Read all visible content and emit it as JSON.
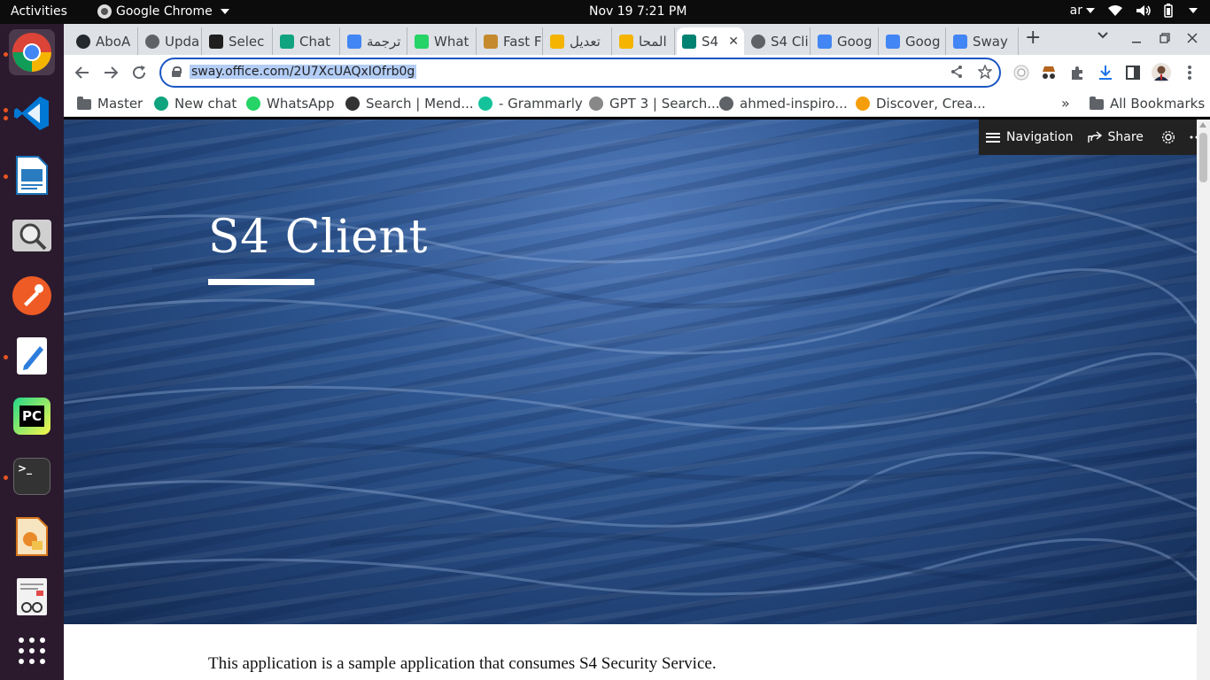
{
  "system": {
    "activities": "Activities",
    "app_name": "Google Chrome",
    "clock": "Nov 19  7:21 PM",
    "keyboard_layout": "ar"
  },
  "tabs": [
    {
      "label": "AboA",
      "icon": "github-icon",
      "color": "#24292e"
    },
    {
      "label": "Upda",
      "icon": "globe-icon",
      "color": "#5f6368"
    },
    {
      "label": "Selec",
      "icon": "a-logo-icon",
      "color": "#1f1f1f"
    },
    {
      "label": "Chat",
      "icon": "openai-icon",
      "color": "#10a37f"
    },
    {
      "label": "ترجمة",
      "icon": "google-translate-icon",
      "color": "#4285f4"
    },
    {
      "label": "What",
      "icon": "whatsapp-icon",
      "color": "#25d366"
    },
    {
      "label": "Fast F",
      "icon": "calendar-icon",
      "color": "#c58a2e"
    },
    {
      "label": "تعديل",
      "icon": "five-icon",
      "color": "#f4b400"
    },
    {
      "label": "المحا",
      "icon": "five-icon",
      "color": "#f4b400"
    },
    {
      "label": "S4",
      "icon": "sway-icon",
      "color": "#008272",
      "active": true
    },
    {
      "label": "S4 Cli",
      "icon": "globe-icon",
      "color": "#5f6368"
    },
    {
      "label": "Goog",
      "icon": "google-translate-icon",
      "color": "#4285f4"
    },
    {
      "label": "Goog",
      "icon": "google-translate-icon",
      "color": "#4285f4"
    },
    {
      "label": "Sway",
      "icon": "loading-icon",
      "color": "#4285f4"
    }
  ],
  "omnibox": {
    "url": "sway.office.com/2U7XcUAQxIOfrb0g"
  },
  "bookmarks": [
    {
      "label": "Master",
      "icon": "folder-icon"
    },
    {
      "label": "New chat",
      "icon": "openai-icon",
      "color": "#10a37f"
    },
    {
      "label": "WhatsApp",
      "icon": "whatsapp-icon",
      "color": "#25d366"
    },
    {
      "label": "Search | Mend...",
      "icon": "mendeley-icon",
      "color": "#333"
    },
    {
      "label": "- Grammarly",
      "icon": "grammarly-icon",
      "color": "#15c39a"
    },
    {
      "label": "GPT 3 | Search...",
      "icon": "e-icon",
      "color": "#888"
    },
    {
      "label": "ahmed-inspiro...",
      "icon": "globe-icon",
      "color": "#5f6368"
    },
    {
      "label": "Discover, Crea...",
      "icon": "layers-icon",
      "color": "#f59e0b"
    }
  ],
  "all_bookmarks": "All Bookmarks",
  "sway": {
    "navigation": "Navigation",
    "share": "Share"
  },
  "page": {
    "title": "S4 Client",
    "body": "This application is a sample application that consumes S4 Security Service."
  }
}
